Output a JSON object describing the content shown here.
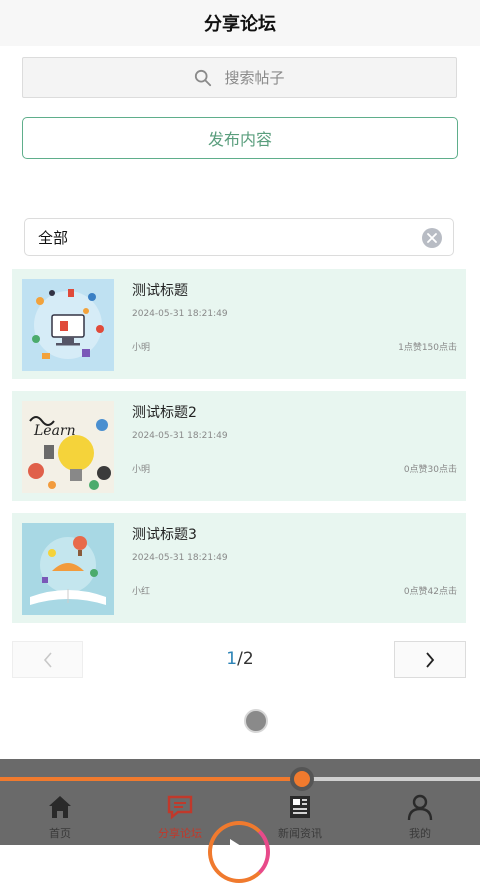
{
  "header": {
    "title": "分享论坛"
  },
  "search": {
    "placeholder": "搜索帖子"
  },
  "publish": {
    "label": "发布内容"
  },
  "filter": {
    "value": "全部"
  },
  "posts": [
    {
      "title": "测试标题",
      "date": "2024-05-31 18:21:49",
      "author": "小明",
      "stats": "1点赞150点击"
    },
    {
      "title": "测试标题2",
      "date": "2024-05-31 18:21:49",
      "author": "小明",
      "stats": "0点赞30点击"
    },
    {
      "title": "测试标题3",
      "date": "2024-05-31 18:21:49",
      "author": "小红",
      "stats": "0点赞42点击"
    }
  ],
  "pager": {
    "current": "1",
    "separator": "/",
    "total": "2"
  },
  "video": {
    "progress": 0.63
  },
  "tabs": [
    {
      "label": "首页",
      "icon": "home-icon",
      "active": false
    },
    {
      "label": "分享论坛",
      "icon": "forum-icon",
      "active": true
    },
    {
      "label": "新闻资讯",
      "icon": "news-icon",
      "active": false
    },
    {
      "label": "我的",
      "icon": "user-icon",
      "active": false
    }
  ],
  "colors": {
    "accent": "#5fae8b",
    "card_bg": "#e8f6f0",
    "active_tab": "#c0392b",
    "progress": "#f07a2e"
  }
}
